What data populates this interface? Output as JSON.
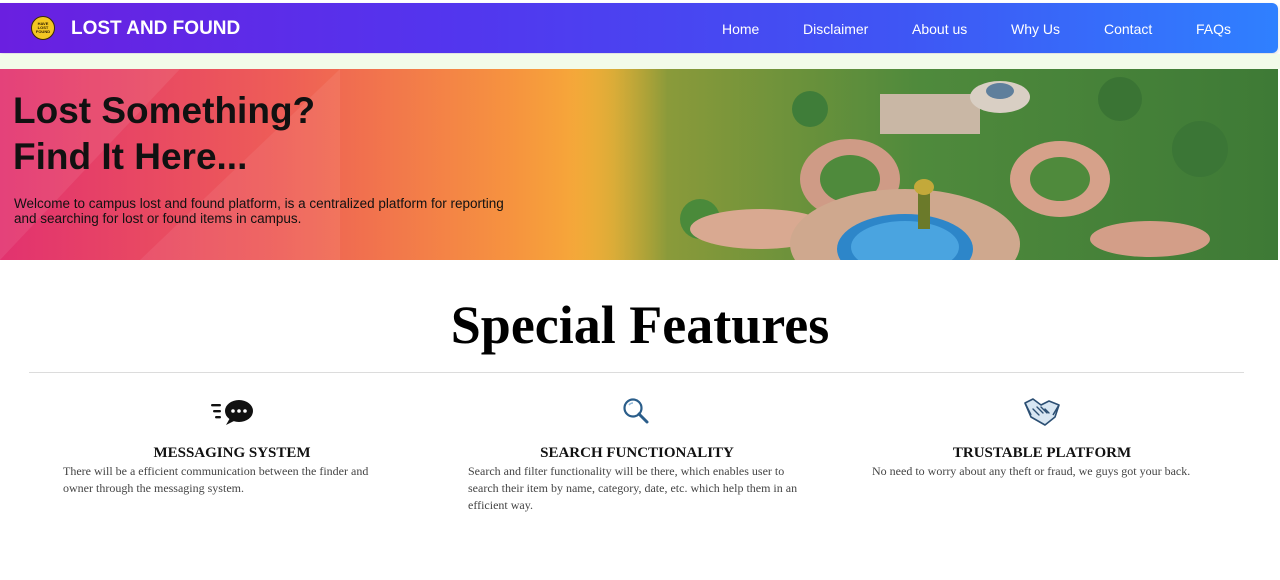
{
  "navbar": {
    "logo_text": "HAVE LOST FOUND",
    "brand": "LOST AND FOUND",
    "links": [
      "Home",
      "Disclaimer",
      "About us",
      "Why Us",
      "Contact",
      "FAQs"
    ]
  },
  "hero": {
    "title_line1": "Lost Something?",
    "title_line2": "Find It Here...",
    "description": "Welcome to campus lost and found platform, is a centralized platform for reporting and searching for lost or found items in campus."
  },
  "features": {
    "heading": "Special Features",
    "items": [
      {
        "icon": "chat-bubble-icon",
        "title": "MESSAGING SYSTEM",
        "description": "There will be a efficient communication between the finder and owner through the messaging system."
      },
      {
        "icon": "magnifier-icon",
        "title": "SEARCH FUNCTIONALITY",
        "description": "Search and filter functionality will be there, which enables user to search their item by name, category, date, etc. which help them in an efficient way."
      },
      {
        "icon": "handshake-icon",
        "title": "TRUSTABLE PLATFORM",
        "description": "No need to worry about any theft or fraud, we guys got your back."
      }
    ]
  },
  "colors": {
    "navbar_start": "#6a1fe0",
    "navbar_end": "#2f80ff",
    "hero_pink": "#e2326f",
    "hero_orange": "#f6933f"
  }
}
